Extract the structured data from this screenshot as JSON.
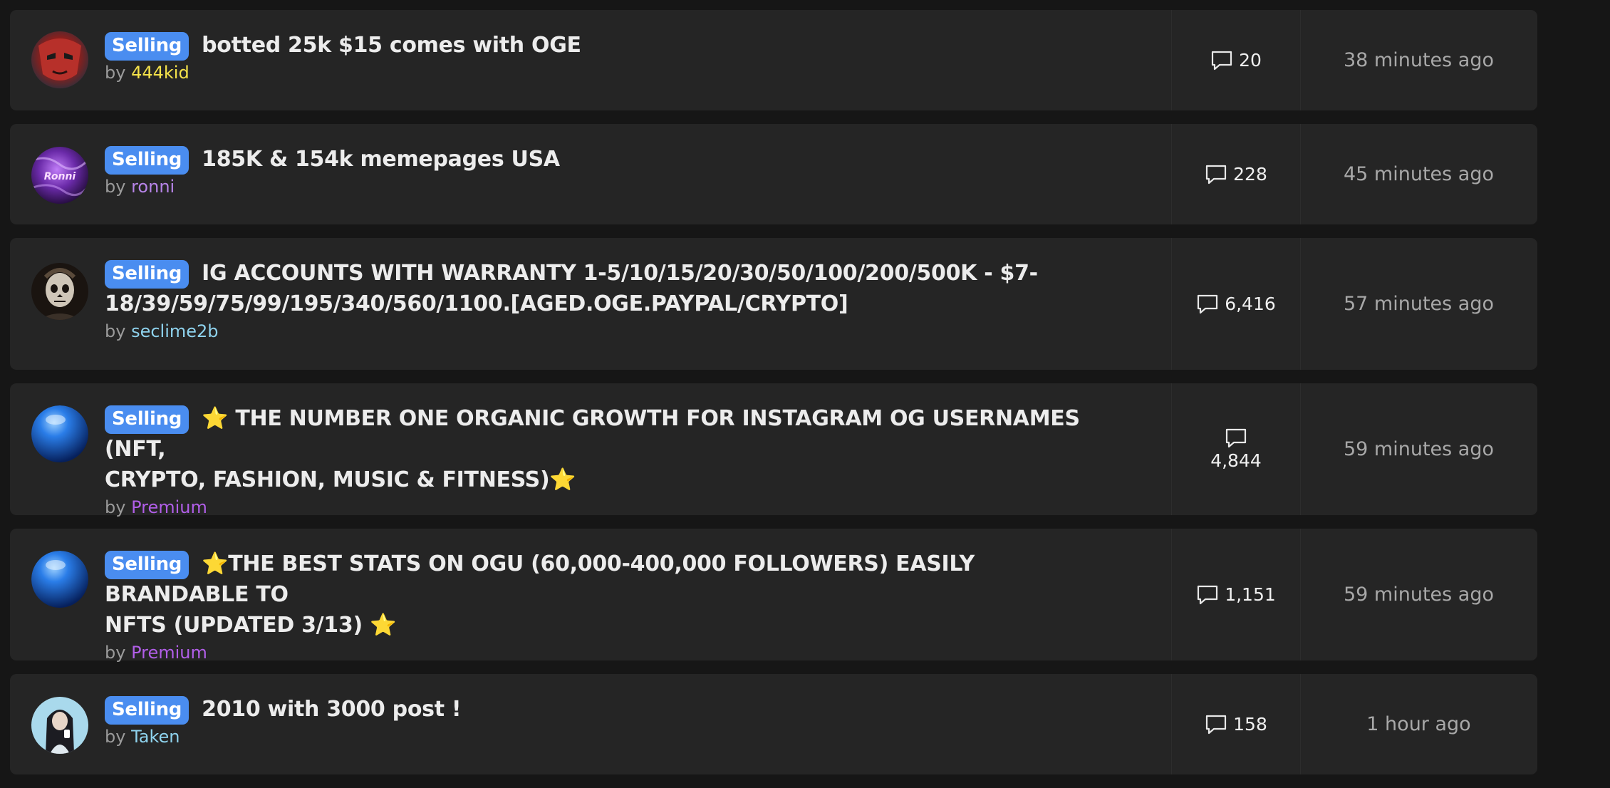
{
  "threads": [
    {
      "prefix": "Selling",
      "title": "botted 25k $15 comes with OGE",
      "by_label": "by",
      "author": "444kid",
      "author_color": "#f4e24a",
      "replies": "20",
      "time": "38 minutes ago",
      "avatar_icon": "red-mask-avatar"
    },
    {
      "prefix": "Selling",
      "title": "185K & 154k memepages USA",
      "by_label": "by",
      "author": "ronni",
      "author_color": "#b784e8",
      "replies": "228",
      "time": "45 minutes ago",
      "avatar_icon": "purple-ronni-avatar",
      "avatar_text": "Ronni"
    },
    {
      "prefix": "Selling",
      "title_line1": "IG ACCOUNTS WITH WARRANTY 1-5/10/15/20/30/50/100/200/500K - $7-",
      "title_line2": "18/39/59/75/99/195/340/560/1100.[AGED.OGE.PAYPAL/CRYPTO]",
      "by_label": "by",
      "author": "seclime2b",
      "author_color": "#8fd3ee",
      "replies": "6,416",
      "time": "57 minutes ago",
      "avatar_icon": "skull-portrait-avatar"
    },
    {
      "prefix": "Selling",
      "star": "⭐",
      "title_line1": "THE NUMBER ONE ORGANIC GROWTH FOR INSTAGRAM OG USERNAMES (NFT,",
      "title_line2": "CRYPTO, FASHION, MUSIC & FITNESS)",
      "by_label": "by",
      "author": "Premium",
      "author_color": "#b15ee8",
      "replies": "4,844",
      "time": "59 minutes ago",
      "avatar_icon": "blue-orb-avatar"
    },
    {
      "prefix": "Selling",
      "star": "⭐",
      "title_line1": "THE BEST STATS ON OGU (60,000-400,000 FOLLOWERS) EASILY BRANDABLE TO",
      "title_line2": "NFTS (UPDATED 3/13)",
      "by_label": "by",
      "author": "Premium",
      "author_color": "#b15ee8",
      "replies": "1,151",
      "time": "59 minutes ago",
      "avatar_icon": "blue-orb-avatar"
    },
    {
      "prefix": "Selling",
      "title": "2010 with 3000 post !",
      "by_label": "by",
      "author": "Taken",
      "author_color": "#8fd3ee",
      "replies": "158",
      "time": "1 hour ago",
      "avatar_icon": "girl-photo-avatar"
    }
  ],
  "colors": {
    "page_bg": "#161616",
    "row_bg": "#252525",
    "prefix_bg": "#4a8df0",
    "title": "#ececec",
    "muted": "#9a9a9a"
  }
}
